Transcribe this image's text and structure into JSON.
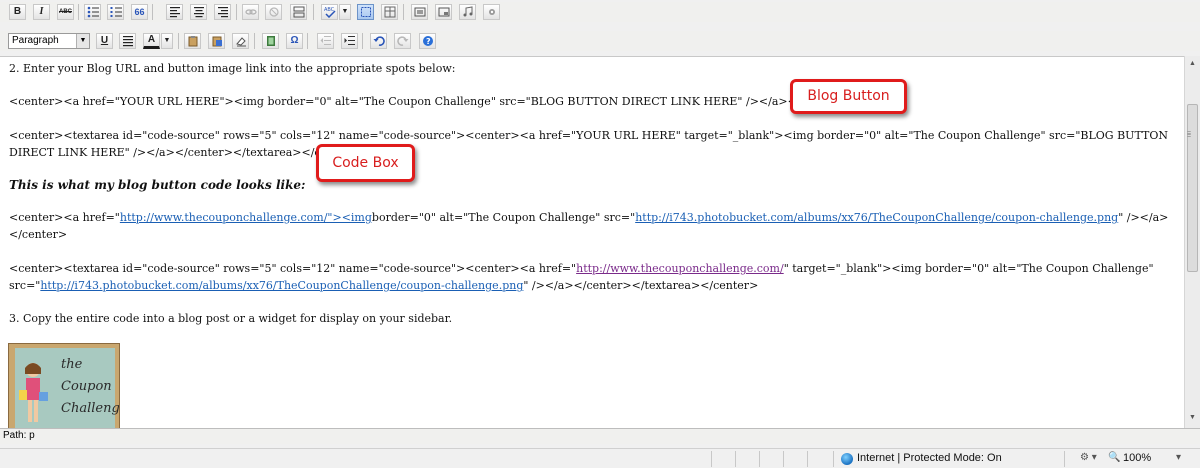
{
  "toolbar1": {
    "bold": "B",
    "italic": "I",
    "strike": "ABC",
    "quote": "66"
  },
  "toolbar2": {
    "format_select": "Paragraph",
    "underline": "U",
    "font_color": "A",
    "omega": "Ω"
  },
  "editor": {
    "step2": "2.  Enter your Blog URL and button image link into the appropriate spots below:",
    "code_button": "<center><a href=\"YOUR URL HERE\"><img border=\"0\" alt=\"The Coupon Challenge\" src=\"BLOG BUTTON DIRECT LINK HERE\" /></a></center>",
    "code_box": "<center><textarea id=\"code-source\" rows=\"5\" cols=\"12\" name=\"code-source\"><center><a href=\"YOUR URL HERE\" target=\"_blank\"><img border=\"0\" alt=\"The Coupon Challenge\" src=\"BLOG BUTTON DIRECT LINK HERE\" /></a></center></textarea></center>",
    "heading": "This is what my blog button code looks like:",
    "ex1_a": "<center><a href=\"",
    "ex1_link1": "http://www.thecouponchallenge.com/\"><img",
    "ex1_b": "border=\"0\" alt=\"The Coupon Challenge\" src=\"",
    "ex1_link2": "http://i743.photobucket.com/albums/xx76/TheCouponChallenge/coupon-challenge.png",
    "ex1_c": "\" /></a></center>",
    "ex2_a": "<center><textarea id=\"code-source\" rows=\"5\" cols=\"12\" name=\"code-source\"><center><a href=\"",
    "ex2_link1": "http://www.thecouponchallenge.com/",
    "ex2_b": "\" target=\"_blank\"><img border=\"0\" alt=\"The Coupon Challenge\" src=\"",
    "ex2_link2": "http://i743.photobucket.com/albums/xx76/TheCouponChallenge/coupon-challenge.png",
    "ex2_c": "\" /></a></center></textarea></center>",
    "step3": "3.  Copy the entire code into a blog post or a widget for display on your sidebar.",
    "button_image_text": "the Coupon Challenge"
  },
  "callouts": {
    "blog_button": "Blog Button",
    "code_box": "Code Box"
  },
  "path_bar": "Path: p",
  "status_bar": {
    "zone": "Internet | Protected Mode: On",
    "zoom": "100%"
  },
  "colors": {
    "callout_border": "#e01b1b",
    "link": "#1a5fb4",
    "visited_link": "#7a2a8a"
  },
  "icons": [
    "bullet-list-icon",
    "numbered-list-icon",
    "align-left-icon",
    "align-center-icon",
    "align-right-icon",
    "link-icon",
    "unlink-icon",
    "spellcheck-icon",
    "undo-icon",
    "redo-icon",
    "help-icon",
    "globe-icon",
    "zoom-icon"
  ]
}
